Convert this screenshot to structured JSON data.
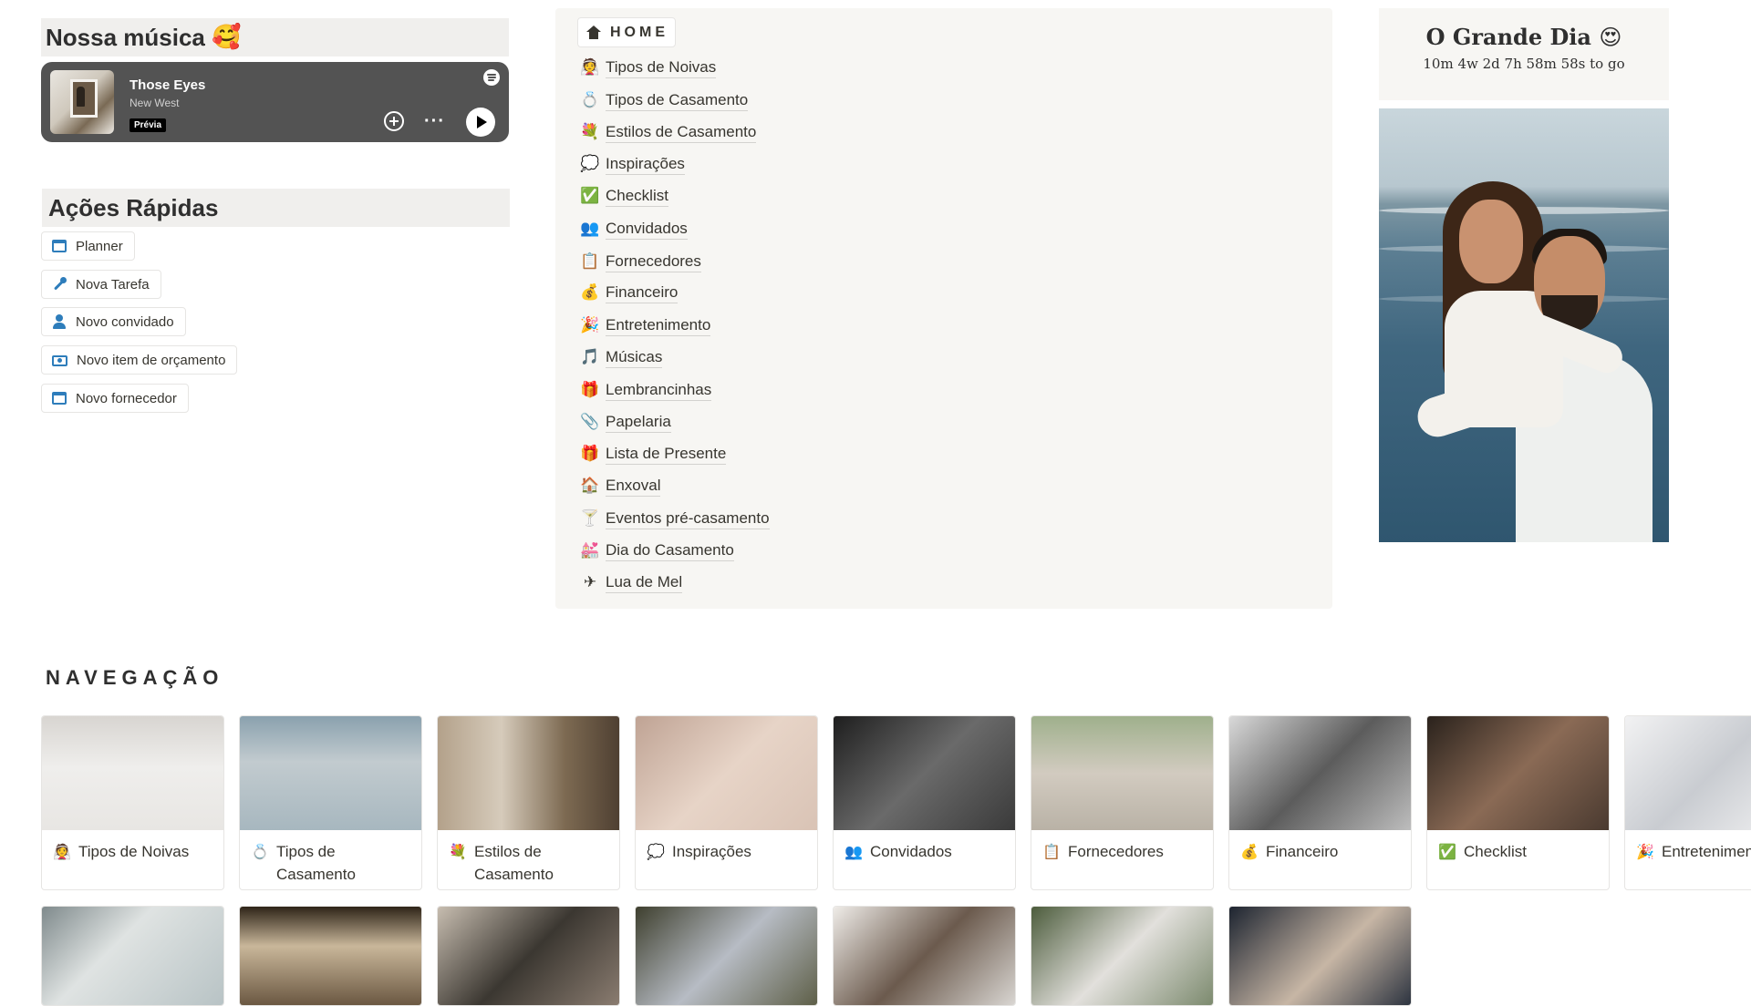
{
  "music": {
    "heading": "Nossa música",
    "heading_emoji": "🥰",
    "player": {
      "track": "Those Eyes",
      "artist": "New West",
      "badge": "Prévia",
      "add_icon": "plus-circle-icon",
      "more_icon": "ellipsis-icon",
      "play_icon": "play-icon",
      "logo_icon": "spotify-icon"
    }
  },
  "quick_actions": {
    "heading": "Ações Rápidas",
    "accent": "#2e7dbb",
    "buttons": [
      {
        "label": "Planner",
        "icon": "calendar-icon"
      },
      {
        "label": "Nova Tarefa",
        "icon": "wrench-icon"
      },
      {
        "label": "Novo convidado",
        "icon": "user-icon"
      },
      {
        "label": "Novo item de orçamento",
        "icon": "money-icon"
      },
      {
        "label": "Novo fornecedor",
        "icon": "calendar-icon"
      }
    ]
  },
  "home": {
    "label": "HOME",
    "icon": "house-icon",
    "links": [
      {
        "emoji": "👰",
        "label": "Tipos de Noivas"
      },
      {
        "emoji": "💍",
        "label": "Tipos de Casamento"
      },
      {
        "emoji": "💐",
        "label": "Estilos de Casamento"
      },
      {
        "emoji": "💭",
        "label": "Inspirações"
      },
      {
        "emoji": "✅",
        "label": "Checklist"
      },
      {
        "emoji": "👥",
        "label": "Convidados"
      },
      {
        "emoji": "📋",
        "label": "Fornecedores"
      },
      {
        "emoji": "💰",
        "label": "Financeiro"
      },
      {
        "emoji": "🎉",
        "label": "Entretenimento"
      },
      {
        "emoji": "🎵",
        "label": "Músicas"
      },
      {
        "emoji": "🎁",
        "label": "Lembrancinhas"
      },
      {
        "emoji": "📎",
        "label": "Papelaria"
      },
      {
        "emoji": "🎁",
        "label": "Lista de Presente"
      },
      {
        "emoji": "🏠",
        "label": "Enxoval"
      },
      {
        "emoji": "🍸",
        "label": "Eventos pré-casamento"
      },
      {
        "emoji": "💒",
        "label": "Dia do Casamento"
      },
      {
        "emoji": "✈",
        "label": "Lua de Mel"
      }
    ]
  },
  "countdown": {
    "title": "O Grande Dia",
    "title_emoji": "😍",
    "remaining": "10m 4w 2d 7h 58m 58s to go"
  },
  "navigation": {
    "heading": "NAVEGAÇÃO",
    "cards": [
      {
        "emoji": "👰",
        "label": "Tipos de Noivas",
        "cover": "#e8e6e3"
      },
      {
        "emoji": "💍",
        "label": "Tipos de Casamento",
        "cover": "#a7b7bf"
      },
      {
        "emoji": "💐",
        "label": "Estilos de Casamento",
        "cover": "#b3a18a"
      },
      {
        "emoji": "💭",
        "label": "Inspirações",
        "cover": "#d9c3b5"
      },
      {
        "emoji": "👥",
        "label": "Convidados",
        "cover": "#3a3a3a"
      },
      {
        "emoji": "📋",
        "label": "Fornecedores",
        "cover": "#b9b2a6"
      },
      {
        "emoji": "💰",
        "label": "Financeiro",
        "cover": "#8f8f8f"
      },
      {
        "emoji": "✅",
        "label": "Checklist",
        "cover": "#4a3a30"
      },
      {
        "emoji": "🎉",
        "label": "Entretenimento",
        "cover": "#e5e6e8"
      }
    ],
    "second_row_covers": [
      "#b8c3c5",
      "#6b5842",
      "#8a7c70",
      "#5e5f48",
      "#d9d6d2",
      "#7c8a6e",
      "#2d3440"
    ]
  }
}
